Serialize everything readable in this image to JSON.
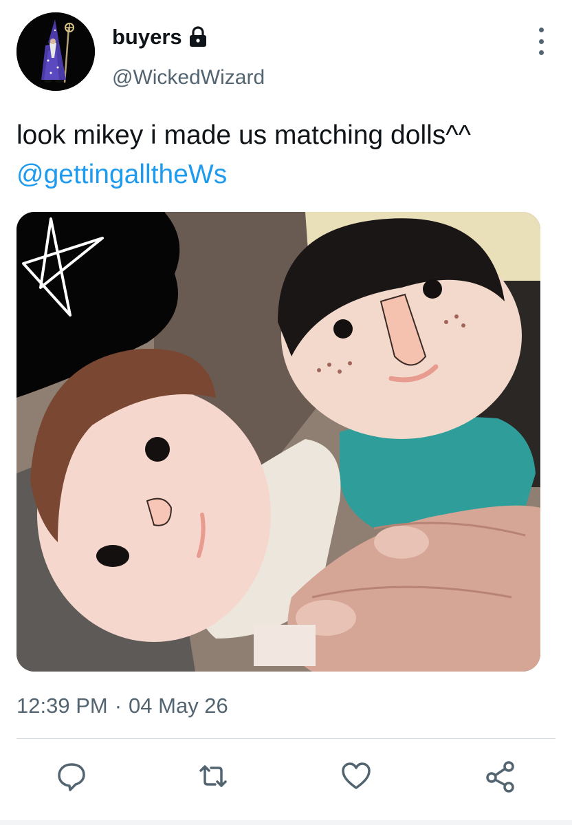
{
  "user": {
    "display_name": "buyers",
    "handle": "@WickedWizard",
    "locked": true,
    "avatar_icon": "wizard-avatar"
  },
  "tweet": {
    "text_before_mention": "look mikey i made us matching dolls^^ ",
    "mention": "@gettingalltheWs",
    "media_alt": "",
    "time": "12:39 PM",
    "separator": "·",
    "date": "04 May 26"
  },
  "actions": [
    {
      "icon": "reply-icon"
    },
    {
      "icon": "retweet-icon"
    },
    {
      "icon": "like-icon"
    },
    {
      "icon": "share-icon"
    }
  ],
  "colors": {
    "mention": "#1d9bf0",
    "secondary_text": "#536471",
    "primary_text": "#0f1419",
    "divider": "#cfd9de"
  }
}
